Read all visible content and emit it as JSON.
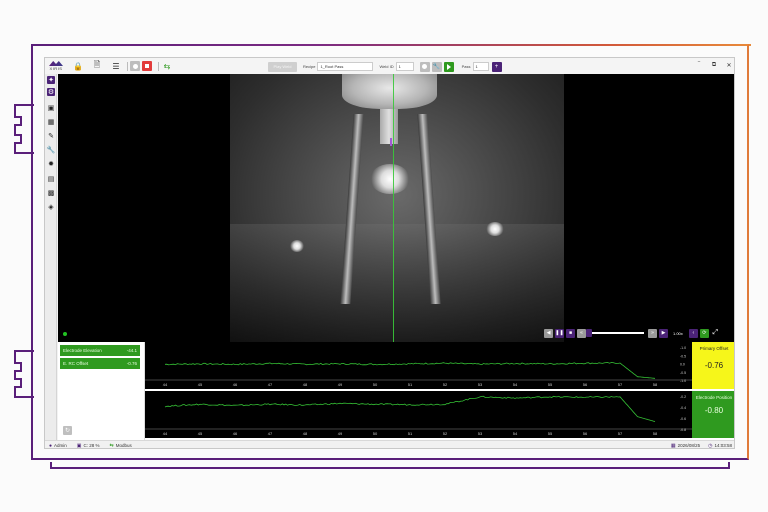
{
  "app": {
    "logo_text": "XIRIS"
  },
  "toolbar": {
    "ghost_button_label": "Play Weld",
    "recipe_label": "Recipe",
    "recipe_value": "1_Root Pass",
    "weld_id_label": "Weld ID",
    "weld_id_value": "1",
    "pass_label": "Pass",
    "pass_value": "1",
    "pass_add_label": "+",
    "minimize": "‾",
    "restore": "⧉",
    "close": "✕"
  },
  "player": {
    "speed": "1.00x",
    "progress": 0.0
  },
  "parameters": [
    {
      "label": "Electrode Elevation",
      "value": "-44.1"
    },
    {
      "label": "E. RC Offset",
      "value": "-0.76"
    }
  ],
  "plots": [
    {
      "ticks": [
        "44",
        "45",
        "46",
        "47",
        "48",
        "49",
        "50",
        "51",
        "52",
        "53",
        "54",
        "55",
        "56",
        "57",
        "58"
      ],
      "y_ticks": [
        "-1.0",
        "-0.5",
        "0.0",
        "-0.5",
        "-1.0"
      ],
      "readout_label": "Primary Offset",
      "readout_value": "-0.76"
    },
    {
      "ticks": [
        "44",
        "45",
        "46",
        "47",
        "48",
        "49",
        "50",
        "51",
        "52",
        "53",
        "54",
        "55",
        "56",
        "57",
        "58"
      ],
      "y_ticks": [
        "-0.2",
        "-0.4",
        "-0.6",
        "-0.8"
      ],
      "readout_label": "Electrode Position",
      "readout_value": "-0.80"
    }
  ],
  "chart_data": [
    {
      "type": "line",
      "x": [
        44,
        45,
        46,
        47,
        48,
        49,
        50,
        51,
        52,
        53,
        54,
        55,
        56,
        57,
        57.5,
        58
      ],
      "series": [
        {
          "values": [
            -0.05,
            -0.02,
            -0.05,
            0.0,
            -0.04,
            -0.02,
            -0.05,
            -0.02,
            0.02,
            -0.04,
            0.0,
            -0.02,
            0.02,
            0.03,
            -0.8,
            -0.9
          ]
        }
      ],
      "ylim": [
        -1.0,
        1.0
      ]
    },
    {
      "type": "line",
      "x": [
        44,
        45,
        46,
        47,
        48,
        49,
        50,
        51,
        52,
        53,
        54,
        55,
        56,
        57,
        57.5,
        58
      ],
      "series": [
        {
          "values": [
            -0.35,
            -0.3,
            -0.33,
            -0.3,
            -0.32,
            -0.28,
            -0.3,
            -0.31,
            -0.3,
            -0.12,
            -0.15,
            -0.12,
            -0.13,
            -0.12,
            -0.6,
            -0.72
          ]
        }
      ],
      "ylim": [
        -0.9,
        -0.1
      ]
    }
  ],
  "status": {
    "user": "Admin",
    "disk": "C: 28 %",
    "protocol": "Modbus",
    "date": "2026/08/25",
    "time": "14:03:58"
  },
  "colors": {
    "brand_purple": "#4b2377",
    "param_green": "#2f9a1f",
    "readout_yellow": "#f6f61a",
    "trace_green": "#35c135"
  }
}
